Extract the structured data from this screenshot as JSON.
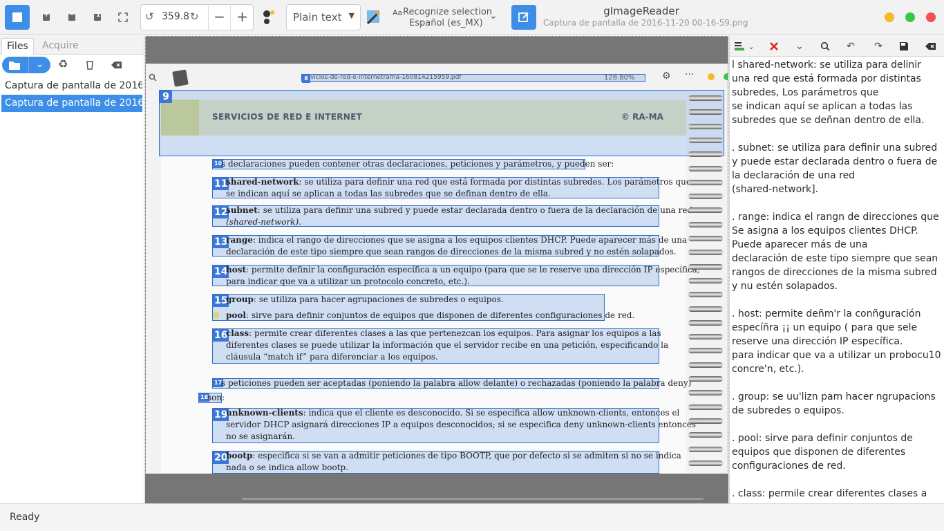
{
  "app": {
    "title": "gImageReader",
    "subtitle": "Captura de pantalla de 2016-11-20 00-16-59.png"
  },
  "toolbar": {
    "rotation": "359.8",
    "mode": "Plain text",
    "recognize_label": "Recognize selection",
    "language": "Español (es_MX)"
  },
  "sidebar": {
    "tabs": [
      "Files",
      "Acquire"
    ],
    "files": [
      {
        "label": "Captura de pantalla de 2016...",
        "selected": false
      },
      {
        "label": "Captura de pantalla de 2016...",
        "selected": true
      }
    ]
  },
  "viewer": {
    "doc_title": "vicios-de-red-e-internetrama-160814215959.pdf",
    "zoom": "128.80%",
    "header_title": "SERVICIOS DE RED E INTERNET",
    "header_right": "© RA-MA",
    "regions": [
      {
        "n": "9"
      },
      {
        "n": "8"
      },
      {
        "n": "10",
        "lines": [
          "s declaraciones pueden contener otras declaraciones, peticiones y parámetros, y pueden ser:"
        ]
      },
      {
        "n": "11",
        "term": "shared-network",
        "lines": [
          ": se utiliza para definir una red que está formada por distintas subredes. Los parámetros que",
          "se indican aquí se aplican a todas las subredes que se definan dentro de ella."
        ]
      },
      {
        "n": "12",
        "term": "subnet",
        "lines": [
          ": se utiliza para definir una subred y puede estar declarada dentro o fuera de la declaración de una red",
          "(shared-network)."
        ]
      },
      {
        "n": "13",
        "term": "range",
        "lines": [
          ": indica el rango de direcciones que se asigna a los equipos clientes DHCP. Puede aparecer más de una",
          "declaración de este tipo siempre que sean rangos de direcciones de la misma subred y no estén solapados."
        ]
      },
      {
        "n": "14",
        "term": "host",
        "lines": [
          ": permite definir la configuración específica a un equipo (para que se le reserve una dirección IP específica,",
          "para indicar que va a utilizar un protocolo concreto, etc.)."
        ]
      },
      {
        "n": "15",
        "term": "group",
        "lines": [
          ": se utiliza para hacer agrupaciones de subredes o equipos."
        ]
      },
      {
        "n": "",
        "term": "pool",
        "lines": [
          ": sirve para definir conjuntos de equipos que disponen de diferentes configuraciones de red."
        ]
      },
      {
        "n": "16",
        "term": "class",
        "lines": [
          ": permite crear diferentes clases a las que pertenezcan los equipos. Para asignar los equipos a las",
          "diferentes clases se puede utilizar la información que el servidor recibe en una petición, especificando la",
          "cláusula “match if” para diferenciar a los equipos."
        ]
      },
      {
        "n": "17",
        "lines": [
          "s peticiones pueden ser aceptadas (poniendo la palabra allow delante) o rechazadas (poniendo la palabra deny)"
        ]
      },
      {
        "n": "18",
        "lines": [
          "son:"
        ]
      },
      {
        "n": "19",
        "term": "unknown-clients",
        "lines": [
          ": indica que el cliente es desconocido. Si se especifica allow unknown-clients, entonces el",
          "servidor DHCP asignará direcciones IP a equipos desconocidos; si se especifica deny unknown-clients entonces",
          "no se asignarán."
        ]
      },
      {
        "n": "20",
        "term": "bootp",
        "lines": [
          ": especifica si se van a admitir peticiones de tipo BOOTP, que por defecto si se admiten si no se indica",
          "nada o se indica allow bootp."
        ]
      }
    ]
  },
  "ocr_output": [
    "l shared-network: se utiliza para delinir una red que está formada por distintas subredes, Los parámetros que\nse indican aquí se aplican a todas las subredes que se deñnan dentro de ella.",
    ". subnet: se utiliza para definir una subred y puede estar declarada dentro o fuera de la declaración de una red\n(shared-network].",
    ". range: indica el rangn de direcciones que Se asigna a los equipos clientes DHCP. Puede aparecer más de una\ndeclaración de este tipo siempre que sean rangos de direcciones de la misma subred y nu estén solapados.",
    ". host: permite deñm'r la conñguración especíñra ¡¡ un equipo ( para que sele reserve una dirección IP específica.\npara indicar que va a utilizar un probocu10 concre'n, etc.).",
    ". group: se uu'lizn pam hacer ngrupacions de subredes o equipos.",
    ". pool: sirve para definir conjuntos de equipos que disponen de diferentes configuraciones de red.",
    ". class: permile crear diferentes clases a Ins"
  ],
  "status": "Ready",
  "colors": {
    "accent": "#3d8ee6",
    "selection": "#3d78d8",
    "win_min": "#f7b924",
    "win_max": "#34c749",
    "win_close": "#f25056"
  }
}
